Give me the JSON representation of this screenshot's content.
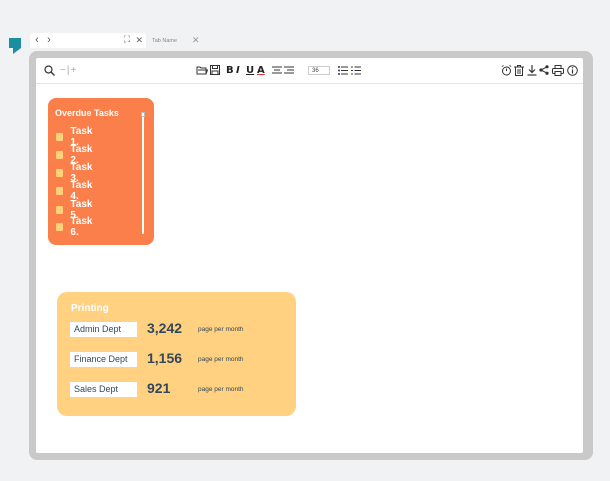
{
  "colors": {
    "overdue_card": "#fb7f4b",
    "printing_card": "#ffd180",
    "logo": "#1a8fa0",
    "text_dark": "#33475b"
  },
  "tabs": {
    "inactive_label": "Tab Name"
  },
  "overdue": {
    "title": "Overdue Tasks",
    "tasks": [
      "Task 1.",
      "Task 2.",
      "Task 3.",
      "Task 4.",
      "Task 5.",
      "Task 6."
    ]
  },
  "printing": {
    "title": "Printing",
    "rows": [
      {
        "dept": "Admin Dept",
        "value": "3,242",
        "unit": "page per month"
      },
      {
        "dept": "Finance Dept",
        "value": "1,156",
        "unit": "page per month"
      },
      {
        "dept": "Sales Dept",
        "value": "921",
        "unit": "page per month"
      }
    ]
  },
  "toolbar": {
    "zoom_label": "−|+",
    "bold": "B",
    "italic": "I",
    "underline": "U",
    "text_color": "A",
    "font_size": "36",
    "icons": [
      "search-icon",
      "open-folder-icon",
      "save-icon",
      "align-center-icon",
      "align-right-icon",
      "bullet-list-icon",
      "numbered-list-icon",
      "alarm-icon",
      "trash-icon",
      "download-icon",
      "share-icon",
      "print-icon",
      "info-icon"
    ]
  }
}
